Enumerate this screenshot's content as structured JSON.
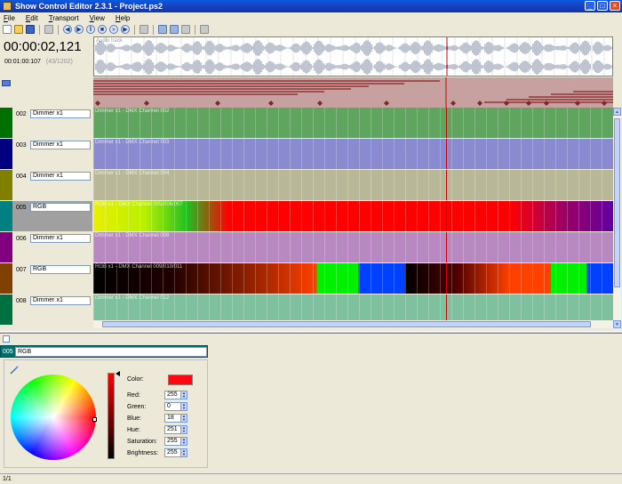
{
  "window": {
    "title": "Show Control Editor 2.3.1 - Project.ps2"
  },
  "window_controls": {
    "minimize": "_",
    "maximize": "□",
    "close": "×"
  },
  "menu": [
    "File",
    "Edit",
    "Transport",
    "View",
    "Help"
  ],
  "toolbar": {
    "icons": [
      "new-icon",
      "open-icon",
      "save-icon",
      "print-icon",
      "rewind-icon",
      "play-icon",
      "pause-icon",
      "stop-icon",
      "next-icon",
      "end-icon",
      "cube-icon",
      "cut-icon",
      "copy-icon",
      "paste-icon",
      "settings-icon"
    ]
  },
  "transport": {
    "timecode": "00:00:02,121",
    "subtime": "00:01:00:107",
    "frames": "(43/1202)"
  },
  "waveform": {
    "label": "Audio track"
  },
  "tracks": [
    {
      "num": "002",
      "name": "Dimmer x1",
      "label": "Dimmer x1 - DMX Channel 002",
      "color": "#007000",
      "fill": "#5fa55f"
    },
    {
      "num": "003",
      "name": "Dimmer x1",
      "label": "Dimmer x1 - DMX Channel 003",
      "color": "#000080",
      "fill": "#8a8ad0"
    },
    {
      "num": "004",
      "name": "Dimmer x1",
      "label": "Dimmer x1 - DMX Channel 004",
      "color": "#808000",
      "fill": "#b8b898"
    },
    {
      "num": "005",
      "name": "RGB",
      "label": "RGB x1 - DMX Channel 005/006/007",
      "color": "#008080",
      "fill": "#ff0000"
    },
    {
      "num": "006",
      "name": "Dimmer x1",
      "label": "Dimmer x1 - DMX Channel 008",
      "color": "#800080",
      "fill": "#b888c0"
    },
    {
      "num": "007",
      "name": "RGB",
      "label": "RGB x1 - DMX Channel 009/010/011",
      "color": "#804000",
      "fill": "#000000"
    },
    {
      "num": "008",
      "name": "Dimmer x1",
      "label": "Dimmer x1 - DMX Channel 012",
      "color": "#007040",
      "fill": "#7fc09f"
    }
  ],
  "properties": {
    "num": "005",
    "name": "RGB",
    "fields": [
      {
        "label": "Red:",
        "value": "255"
      },
      {
        "label": "Green:",
        "value": "0"
      },
      {
        "label": "Blue:",
        "value": "18"
      },
      {
        "label": "Hue:",
        "value": "251"
      },
      {
        "label": "Saturation:",
        "value": "255"
      },
      {
        "label": "Brightness:",
        "value": "255"
      }
    ],
    "color_label": "Color:",
    "color_value": "#ff0612"
  },
  "status": {
    "text": "1/1"
  }
}
